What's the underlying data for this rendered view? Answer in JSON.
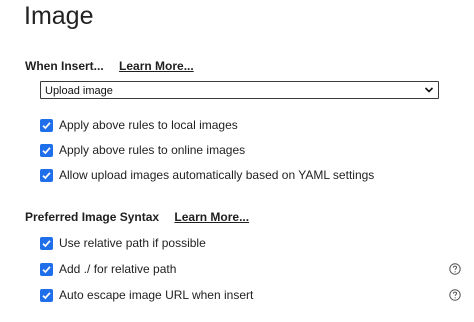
{
  "page": {
    "title": "Image"
  },
  "when_insert": {
    "heading": "When Insert...",
    "learn_more": "Learn More...",
    "select_value": "Upload image",
    "options": [
      {
        "label": "Apply above rules to local images",
        "checked": true
      },
      {
        "label": "Apply above rules to online images",
        "checked": true
      },
      {
        "label": "Allow upload images automatically based on YAML settings",
        "checked": true
      }
    ]
  },
  "preferred_syntax": {
    "heading": "Preferred Image Syntax",
    "learn_more": "Learn More...",
    "options": [
      {
        "label": "Use relative path if possible",
        "checked": true,
        "help_icon": false
      },
      {
        "label": "Add ./ for relative path",
        "checked": true,
        "help_icon": true
      },
      {
        "label": "Auto escape image URL when insert",
        "checked": true,
        "help_icon": true
      }
    ]
  },
  "icons": {
    "checkbox": "checkmark-icon",
    "dropdown": "chevron-down-icon",
    "help": "question-circle-icon"
  },
  "colors": {
    "checkbox_accent": "#1f6feb",
    "text": "#1f1f1f"
  }
}
